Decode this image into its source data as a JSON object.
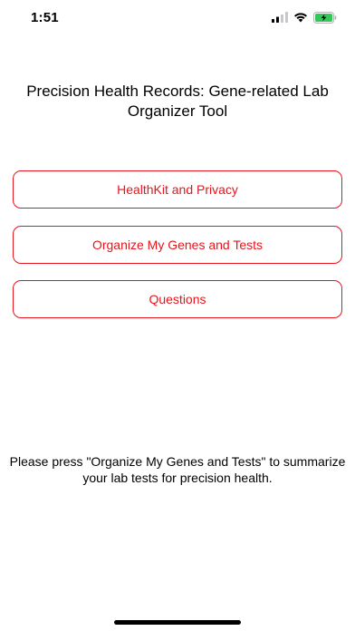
{
  "status_bar": {
    "time": "1:51",
    "icons": [
      "cellular-signal-icon",
      "wifi-icon",
      "battery-charging-icon"
    ]
  },
  "title": "Precision Health Records: Gene-related Lab Organizer Tool",
  "buttons": {
    "healthkit_privacy": "HealthKit and Privacy",
    "organize": "Organize My Genes and Tests",
    "questions": "Questions"
  },
  "instructions": "Please press \"Organize My Genes and Tests\" to summarize your lab tests for precision health.",
  "colors": {
    "accent": "#e8141c",
    "background": "#ffffff",
    "text": "#000000",
    "battery_charge": "#34c759"
  }
}
